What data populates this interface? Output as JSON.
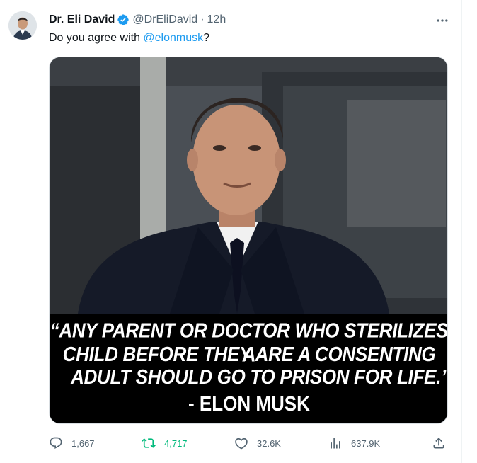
{
  "tweet": {
    "author_name": "Dr. Eli David",
    "handle": "@DrEliDavid",
    "separator": "·",
    "time": "12h",
    "text_before": "Do you agree with ",
    "mention": "@elonmusk",
    "text_after": "?",
    "verified_color": "#1d9bf0",
    "accent_color": "#1d9bf0"
  },
  "media": {
    "quote_lines": [
      "“ANY PARENT OR DOCTOR WHO STERILIZES A",
      "CHILD BEFORE THEY ARE A CONSENTING",
      "ADULT SHOULD GO TO PRISON FOR LIFE.”"
    ],
    "attribution": "- ELON MUSK"
  },
  "actions": {
    "replies": "1,667",
    "reposts": "4,717",
    "likes": "32.6K",
    "views": "637.9K",
    "repost_color": "#00ba7c"
  }
}
